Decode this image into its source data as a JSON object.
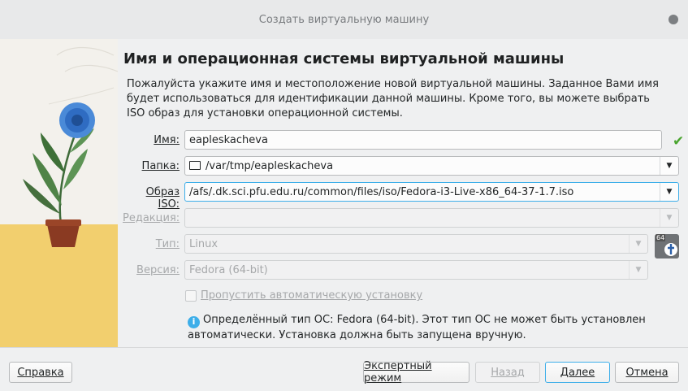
{
  "window": {
    "title": "Создать виртуальную машину"
  },
  "page": {
    "heading": "Имя и операционная системы виртуальной машины",
    "description": "Пожалуйста укажите имя и местоположение новой виртуальной машины. Заданное Вами имя будет использоваться для идентификации данной машины. Кроме того, вы можете выбрать ISO образ для установки операционной системы."
  },
  "form": {
    "name": {
      "label": "Имя:",
      "value": "eapleskacheva"
    },
    "folder": {
      "label": "Папка:",
      "value": "/var/tmp/eapleskacheva"
    },
    "iso": {
      "label": "Образ ISO:",
      "value": "/afs/.dk.sci.pfu.edu.ru/common/files/iso/Fedora-i3-Live-x86_64-37-1.7.iso"
    },
    "edition": {
      "label": "Редакция:",
      "value": ""
    },
    "type": {
      "label": "Тип:",
      "value": "Linux"
    },
    "version": {
      "label": "Версия:",
      "value": "Fedora (64-bit)"
    },
    "os_badge": {
      "bits": "64",
      "icon": "fedora-icon"
    },
    "skip_unattended": {
      "label": "Пропустить автоматическую установку",
      "checked": false
    },
    "info": "Определённый тип ОС: Fedora (64-bit). Этот тип ОС не может быть установлен автоматически. Установка должна быть запущена вручную."
  },
  "buttons": {
    "help": "Справка",
    "expert": "Экспертный режим",
    "back": "Назад",
    "next": "Далее",
    "cancel": "Отмена"
  },
  "colors": {
    "accent": "#3daee9",
    "valid": "#4aa52f",
    "floor": "#f2cf6e"
  }
}
